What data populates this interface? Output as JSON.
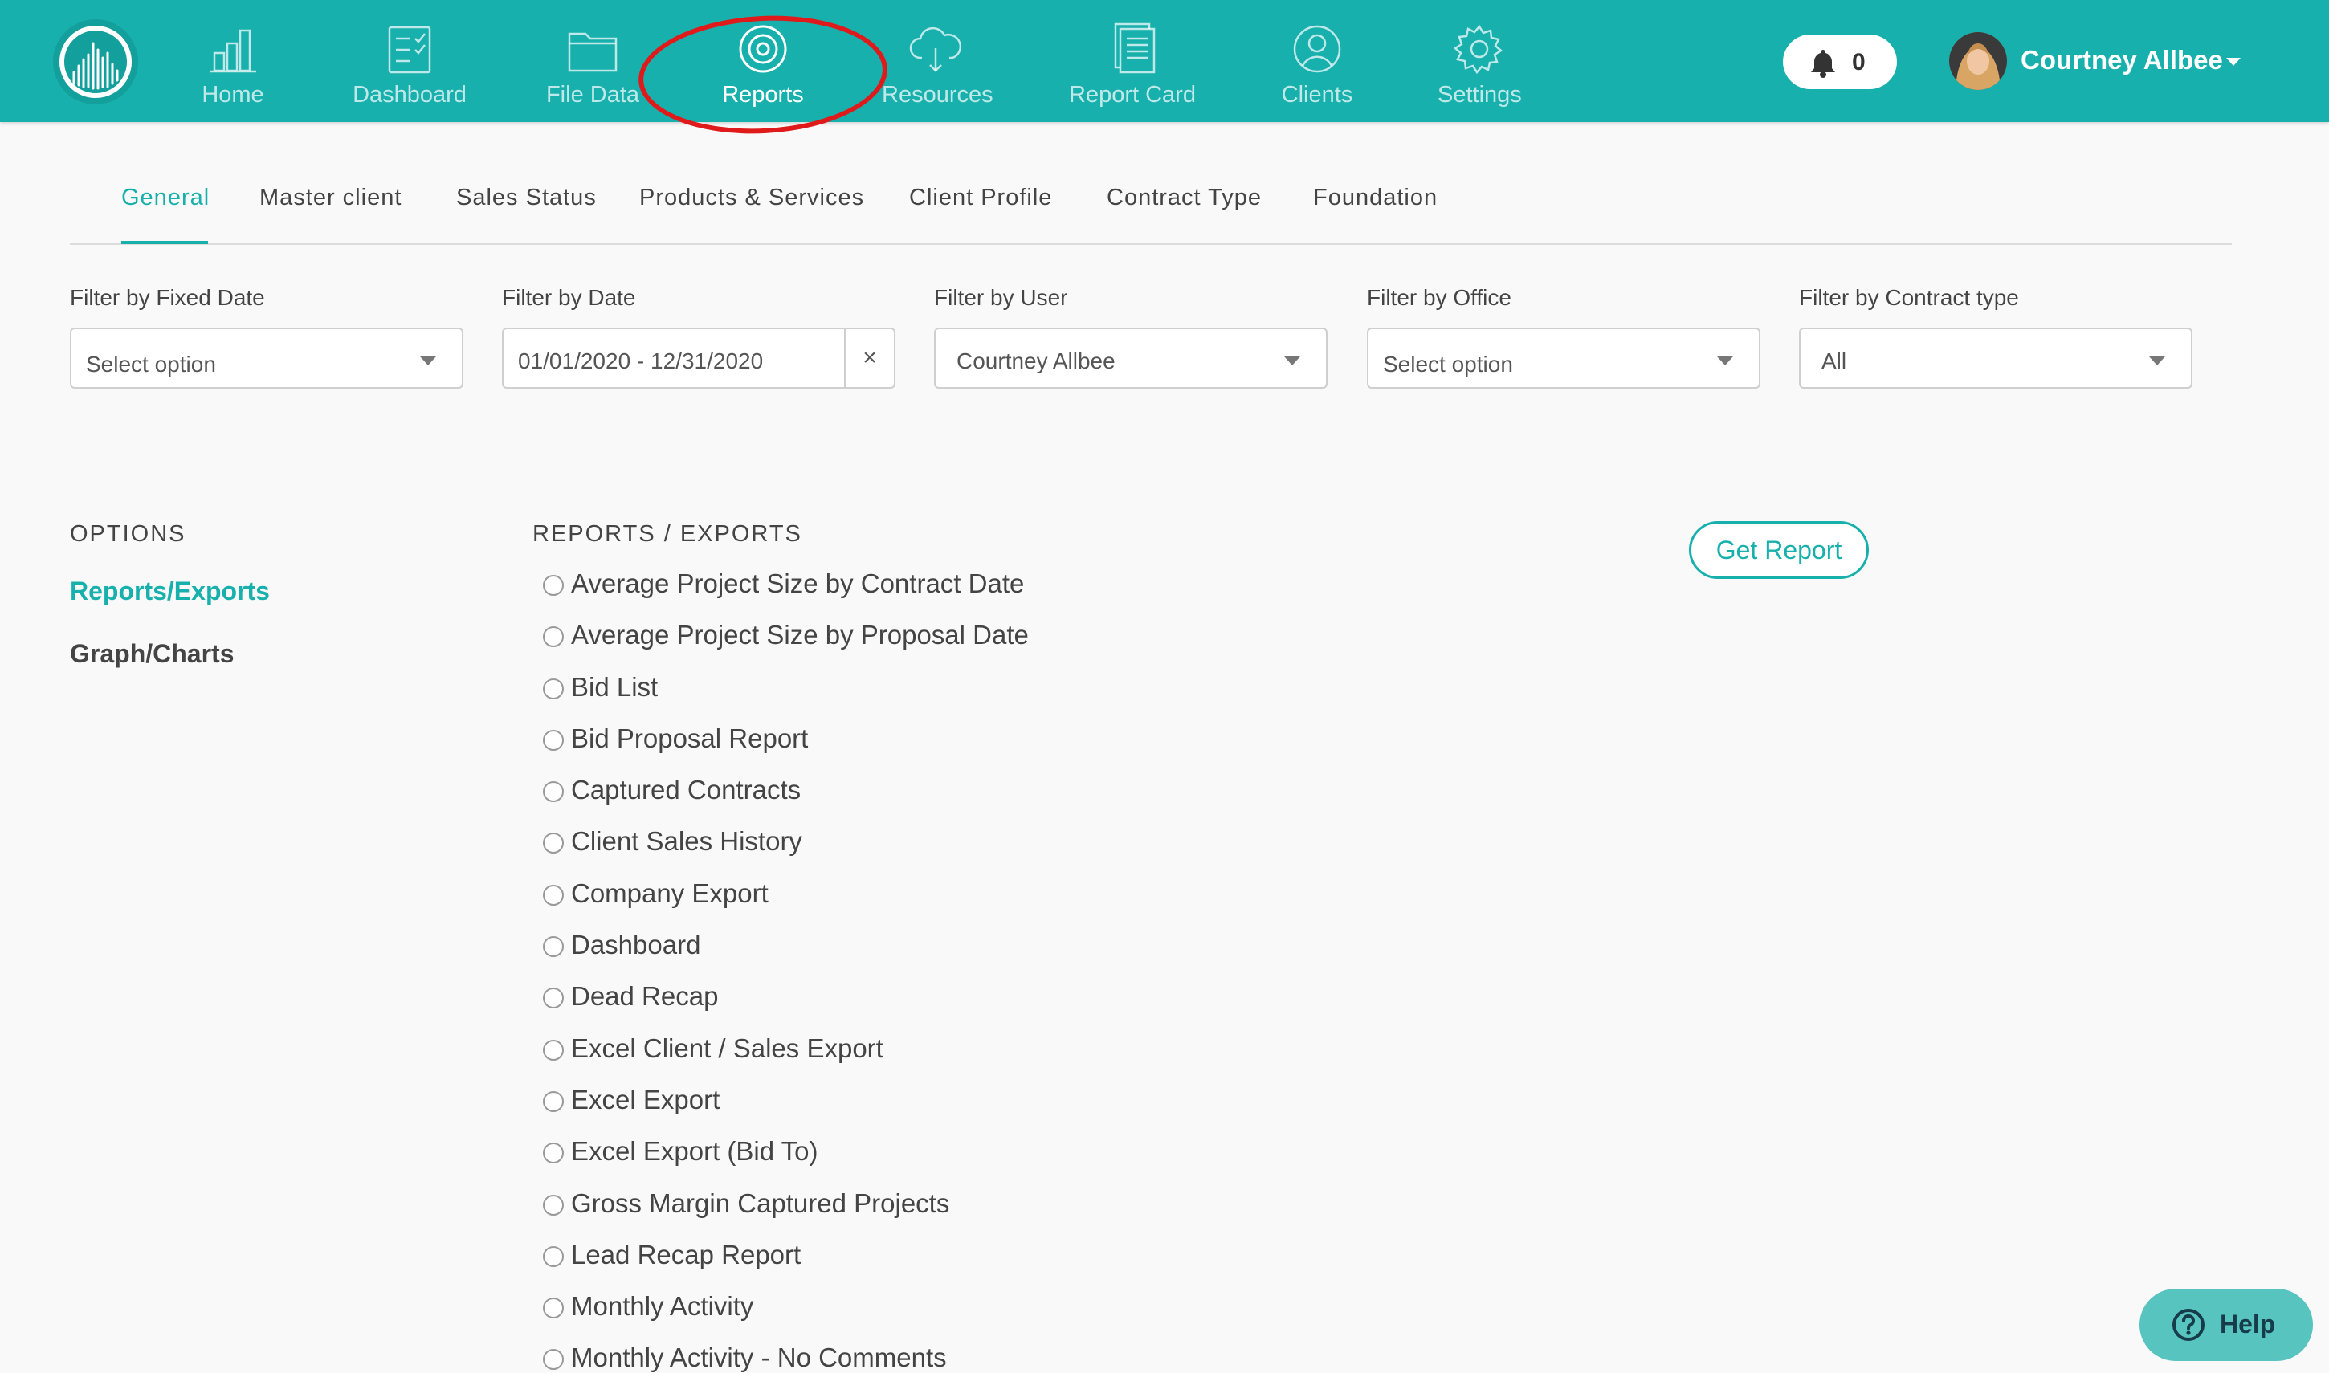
{
  "nav": {
    "items": [
      {
        "label": "Home",
        "icon": "bar-chart-icon"
      },
      {
        "label": "Dashboard",
        "icon": "checklist-icon"
      },
      {
        "label": "File Data",
        "icon": "folder-icon"
      },
      {
        "label": "Reports",
        "icon": "target-icon"
      },
      {
        "label": "Resources",
        "icon": "cloud-download-icon"
      },
      {
        "label": "Report Card",
        "icon": "documents-icon"
      },
      {
        "label": "Clients",
        "icon": "user-circle-icon"
      },
      {
        "label": "Settings",
        "icon": "gear-icon"
      }
    ],
    "active": "Reports",
    "highlight_color": "#e01a1a"
  },
  "notifications": {
    "count": "0"
  },
  "user": {
    "name": "Courtney Allbee"
  },
  "tabs": [
    "General",
    "Master client",
    "Sales Status",
    "Products & Services",
    "Client Profile",
    "Contract Type",
    "Foundation"
  ],
  "active_tab": "General",
  "filters": [
    {
      "label": "Filter by Fixed Date",
      "value": "Select option"
    },
    {
      "label": "Filter by Date",
      "value": "01/01/2020 - 12/31/2020",
      "clear": "×"
    },
    {
      "label": "Filter by User",
      "value": "Courtney Allbee"
    },
    {
      "label": "Filter by Office",
      "value": "Select option"
    },
    {
      "label": "Filter by Contract type",
      "value": "All"
    }
  ],
  "options": {
    "heading": "OPTIONS",
    "items": [
      "Reports/Exports",
      "Graph/Charts"
    ],
    "active": "Reports/Exports"
  },
  "reports": {
    "heading": "REPORTS / EXPORTS",
    "items": [
      "Average Project Size by Contract Date",
      "Average Project Size by Proposal Date",
      "Bid List",
      "Bid Proposal Report",
      "Captured Contracts",
      "Client Sales History",
      "Company Export",
      "Dashboard",
      "Dead Recap",
      "Excel Client / Sales Export",
      "Excel Export",
      "Excel Export (Bid To)",
      "Gross Margin Captured Projects",
      "Lead Recap Report",
      "Monthly Activity",
      "Monthly Activity - No Comments"
    ]
  },
  "get_report_label": "Get Report",
  "help_label": "Help",
  "colors": {
    "accent": "#17b0ad",
    "help_bg": "#57c4c0"
  }
}
